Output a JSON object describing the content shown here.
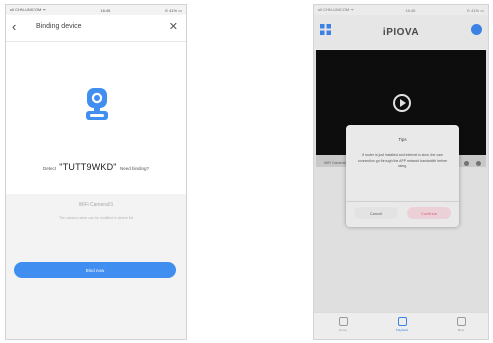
{
  "left": {
    "status": {
      "carrier": "ull CHN-UNICOM ᯤ",
      "time": "16:45",
      "battery": "⊙ 41% ▭"
    },
    "nav": {
      "back_icon": "‹",
      "title": "Binding device",
      "close_icon": "✕"
    },
    "prompt_before": "Detect",
    "device_code": "\"TUTT9WKD\"",
    "prompt_after": "Need binding?",
    "camera_name": "WiFi Camera01",
    "hint": "The camera name can be modified in device list",
    "bind_button": "Bind now",
    "accent_color": "#3f8ef0"
  },
  "right": {
    "status": {
      "carrier": "ull CHN-UNICOM ᯤ",
      "time": "16:45",
      "battery": "⊙ 41% ▭"
    },
    "brand": "iPIOVA",
    "camera_label": "WiFi Camera01",
    "dialog": {
      "title": "Tips",
      "message": "If router is just installed and internet is slow, the cam connection go through the APP network bandwidth before using.",
      "cancel": "Cancel",
      "confirm": "Continue"
    },
    "tabs": [
      {
        "label": "Home",
        "icon": "home-icon"
      },
      {
        "label": "Playback",
        "icon": "playback-icon"
      },
      {
        "label": "Mine",
        "icon": "user-icon"
      }
    ],
    "accent_color": "#3b82e4"
  }
}
